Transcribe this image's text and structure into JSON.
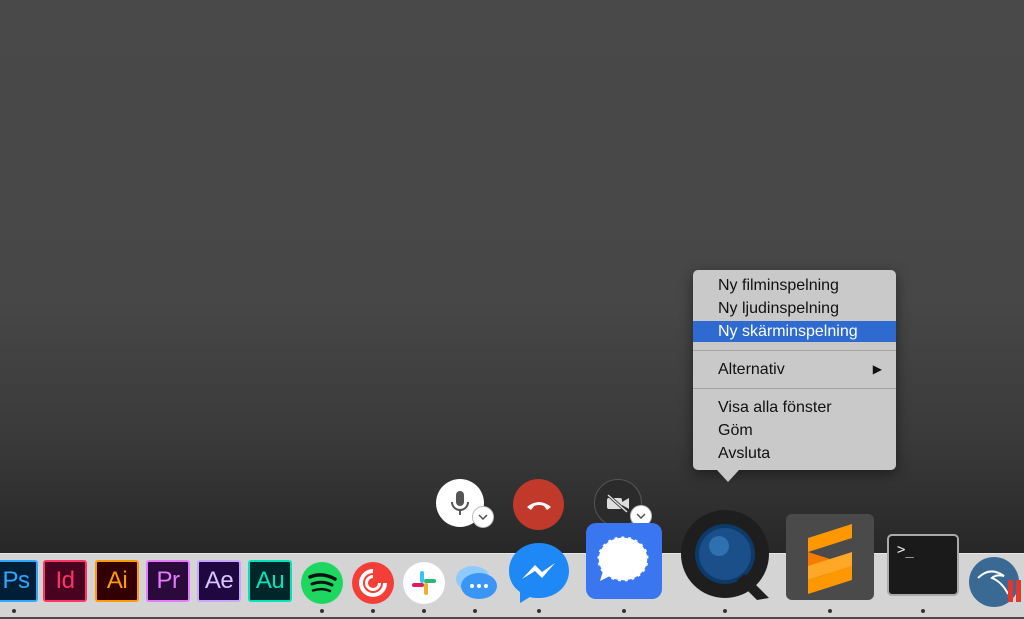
{
  "context_menu": {
    "items": [
      {
        "label": "Ny filminspelning"
      },
      {
        "label": "Ny ljudinspelning"
      },
      {
        "label": "Ny skärminspelning"
      },
      {
        "label": "Alternativ"
      },
      {
        "label": "Visa alla fönster"
      },
      {
        "label": "Göm"
      },
      {
        "label": "Avsluta"
      }
    ],
    "selected": "Ny skärminspelning",
    "submenu_arrow": "▶"
  },
  "colors": {
    "menu_background": "#c9c9c9",
    "menu_highlight": "#2e6ad0",
    "end_call": "#c0392b",
    "dock_background": "#d4d4d4"
  },
  "call_controls": {
    "icons": [
      "microphone-icon",
      "end-call-icon",
      "video-off-icon",
      "chevron-down-icon"
    ]
  },
  "dock": {
    "apps": [
      {
        "name": "photoshop",
        "text": "Ps",
        "icon": "photoshop-icon"
      },
      {
        "name": "indesign",
        "text": "Id",
        "icon": "indesign-icon"
      },
      {
        "name": "illustrator",
        "text": "Ai",
        "icon": "illustrator-icon"
      },
      {
        "name": "premiere",
        "text": "Pr",
        "icon": "premiere-icon"
      },
      {
        "name": "after-effects",
        "text": "Ae",
        "icon": "after-effects-icon"
      },
      {
        "name": "audition",
        "text": "Au",
        "icon": "audition-icon"
      },
      {
        "name": "spotify",
        "icon": "spotify-icon"
      },
      {
        "name": "pocket-casts",
        "icon": "pocket-casts-icon"
      },
      {
        "name": "slack",
        "icon": "slack-icon"
      },
      {
        "name": "messages",
        "icon": "messages-icon"
      },
      {
        "name": "messenger",
        "icon": "messenger-icon"
      },
      {
        "name": "signal",
        "icon": "signal-icon"
      },
      {
        "name": "quicktime",
        "icon": "quicktime-icon"
      },
      {
        "name": "sublime-text",
        "icon": "sublime-text-icon"
      },
      {
        "name": "terminal",
        "text": ">_",
        "icon": "terminal-icon"
      },
      {
        "name": "parallels",
        "icon": "parallels-icon"
      }
    ]
  }
}
